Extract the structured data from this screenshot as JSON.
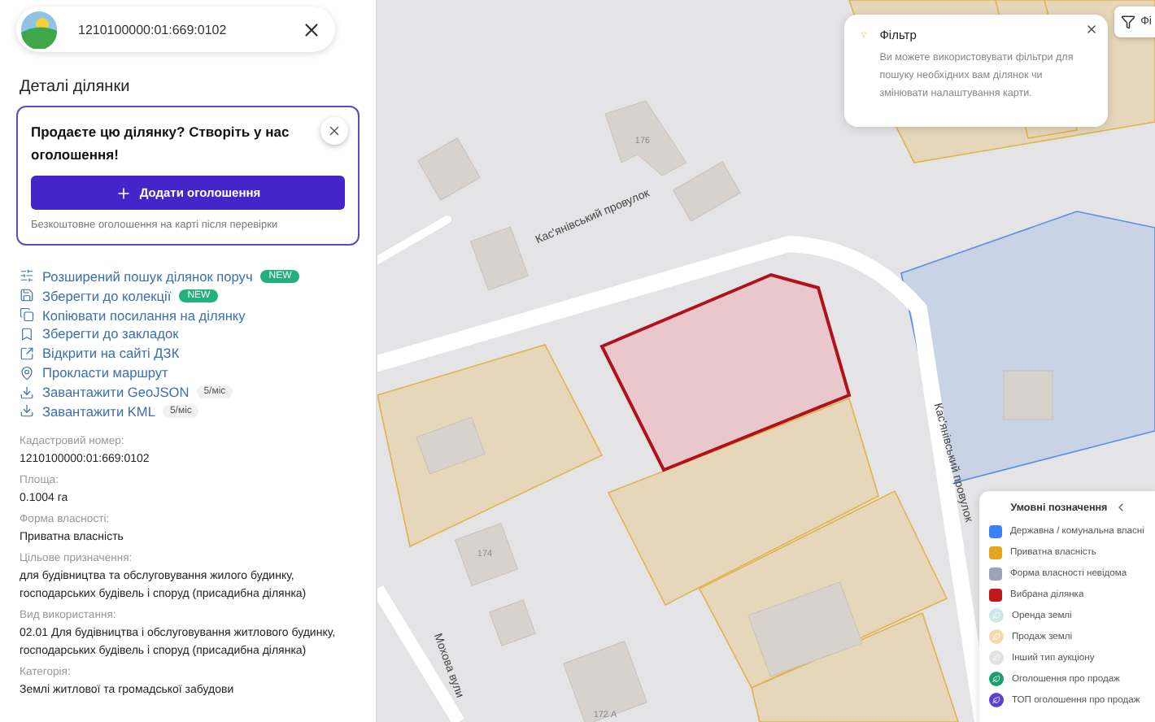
{
  "search": {
    "value": "1210100000:01:669:0102"
  },
  "panel_title": "Деталі ділянки",
  "promo": {
    "title": "Продаєте цю ділянку? Створіть у нас оголошення!",
    "button": "Додати оголошення",
    "note": "Безкоштовне оголошення на карті після перевірки"
  },
  "actions": [
    {
      "kind": "sliders",
      "label": "Розширений пошук ділянок поруч",
      "badge": "NEW"
    },
    {
      "kind": "save",
      "label": "Зберегти до колекції",
      "badge": "NEW"
    },
    {
      "kind": "copy",
      "label": "Копіювати посилання на ділянку"
    },
    {
      "kind": "bookmark",
      "label": "Зберегти до закладок"
    },
    {
      "kind": "external",
      "label": "Відкрити на сайті ДЗК"
    },
    {
      "kind": "pin",
      "label": "Прокласти маршрут"
    },
    {
      "kind": "download",
      "label": "Завантажити GeoJSON",
      "price": "5/міс"
    },
    {
      "kind": "download",
      "label": "Завантажити KML",
      "price": "5/міс"
    }
  ],
  "fields": [
    {
      "label": "Кадастровий номер:",
      "value": "1210100000:01:669:0102"
    },
    {
      "label": "Площа:",
      "value": "0.1004 га"
    },
    {
      "label": "Форма власності:",
      "value": "Приватна власність"
    },
    {
      "label": "Цільове призначення:",
      "value": "для будівництва та обслуговування жилого будинку, господарських будівель і споруд (присадибна ділянка)"
    },
    {
      "label": "Вид використання:",
      "value": "02.01 Для будівництва і обслуговування житлового будинку, господарських будівель і споруд (присадибна ділянка)"
    },
    {
      "label": "Категорія:",
      "value": "Землі житлової та громадської забудови"
    }
  ],
  "map": {
    "street_labels": [
      "Кас'янівський провулок",
      "Кас'янівський провулок",
      "Мохова вули"
    ],
    "house_numbers": [
      "176",
      "174",
      "172 А"
    ]
  },
  "filter_button": {
    "label": "Фі"
  },
  "filter_tip": {
    "title": "Фільтр",
    "text": "Ви можете використовувати фільтри для пошуку необхідних вам ділянок чи змінювати налаштування карти."
  },
  "legend": {
    "title": "Умовні позначення",
    "items": [
      {
        "kind": "square",
        "color": "#3b82f6",
        "label": "Державна / комунальна власні"
      },
      {
        "kind": "square",
        "color": "#e5a421",
        "label": "Приватна власність"
      },
      {
        "kind": "square",
        "color": "#9aa3b8",
        "label": "Форма власності невідома"
      },
      {
        "kind": "square",
        "color": "#c0161c",
        "label": "Вибрана ділянка"
      },
      {
        "kind": "circle",
        "color": "#cfe6ea",
        "label": "Оренда землі"
      },
      {
        "kind": "circle",
        "color": "#f6d9a8",
        "label": "Продаж землі"
      },
      {
        "kind": "circle",
        "color": "#e2e0e0",
        "label": "Інший тип аукціону"
      },
      {
        "kind": "circle",
        "color": "#1a9e6e",
        "label": "Оголошення про продаж"
      },
      {
        "kind": "circle",
        "color": "#5b3fd6",
        "label": "ТОП оголошення про продаж"
      }
    ]
  }
}
